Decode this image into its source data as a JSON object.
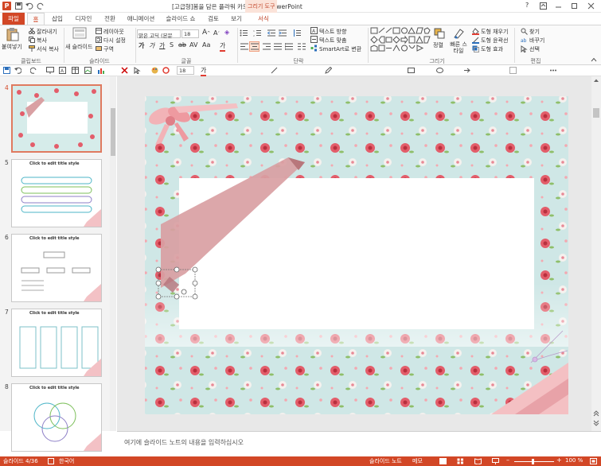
{
  "window": {
    "title": "[고급형]봄을 담은 플라워 카드.pptx - PowerPoint",
    "drawing_tools": "그리기 도구",
    "help": "?"
  },
  "tabs": {
    "file": "파일",
    "home": "홈",
    "insert": "삽입",
    "design": "디자인",
    "transitions": "전환",
    "animations": "애니메이션",
    "slideshow": "슬라이드 쇼",
    "review": "검토",
    "view": "보기",
    "format": "서식"
  },
  "ribbon": {
    "clipboard": {
      "paste": "붙여넣기",
      "cut": "잘라내기",
      "copy": "복사",
      "format_painter": "서식 복사",
      "label": "클립보드"
    },
    "slides": {
      "new_slide": "새 슬라이드",
      "layout": "레이아웃",
      "reset": "다시 설정",
      "section": "구역",
      "label": "슬라이드"
    },
    "font": {
      "family": "맑은 고딕 (본문",
      "size": "18",
      "label": "글꼴"
    },
    "paragraph": {
      "text_direction": "텍스트 방향",
      "align_text": "텍스트 맞춤",
      "smartart": "SmartArt로 변환",
      "label": "단락"
    },
    "drawing": {
      "arrange": "정렬",
      "quick_styles": "빠른 스타일",
      "fill": "도형 채우기",
      "outline": "도형 윤곽선",
      "effects": "도형 효과",
      "label": "그리기"
    },
    "editing": {
      "find": "찾기",
      "replace": "바꾸기",
      "select": "선택",
      "label": "편집"
    }
  },
  "qat": {
    "font_size": "18"
  },
  "thumbnails": [
    {
      "number": "4",
      "title": ""
    },
    {
      "number": "5",
      "title": "Click to edit title style"
    },
    {
      "number": "6",
      "title": "Click to edit title style"
    },
    {
      "number": "7",
      "title": "Click to edit title style"
    },
    {
      "number": "8",
      "title": "Click to edit title style"
    }
  ],
  "notes": {
    "placeholder": "여기에 슬라이드 노트의 내용을 입력하십시오"
  },
  "status": {
    "slide": "슬라이드 4/36",
    "language": "한국어",
    "notes_btn": "슬라이드 노트",
    "comments_btn": "메모",
    "zoom": "100 %"
  },
  "colors": {
    "accent": "#d24726",
    "ribbon_bg": "#fafafa",
    "slide_bg": "#cfe7e6"
  }
}
